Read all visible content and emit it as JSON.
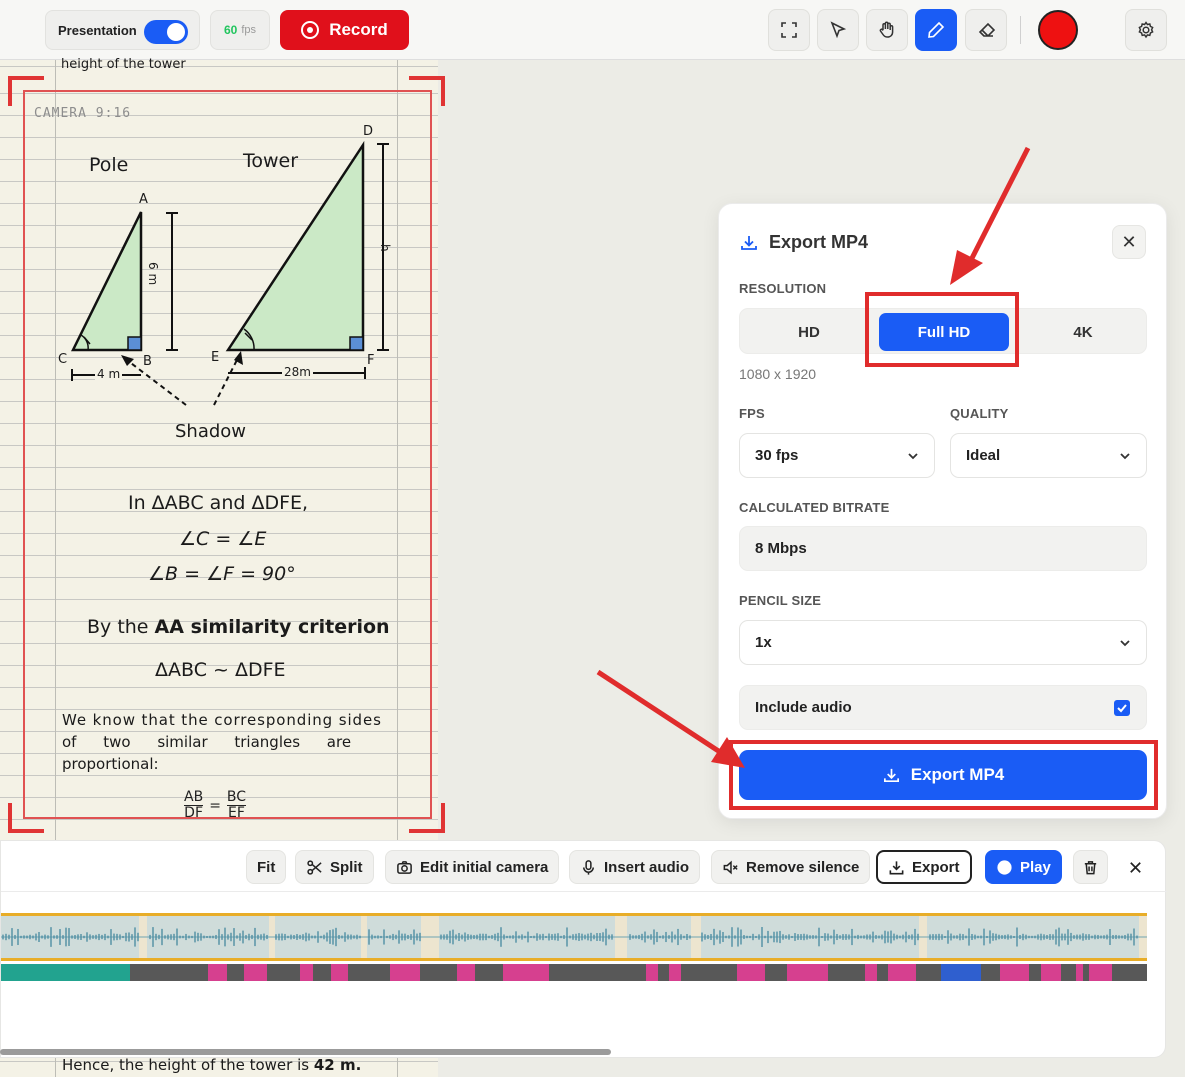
{
  "toolbar": {
    "presentation_label": "Presentation",
    "presentation_on": true,
    "fps_value": "60",
    "fps_unit": "fps",
    "record_label": "Record",
    "tools": [
      "fullscreen-icon",
      "pointer-icon",
      "hand-icon",
      "pencil-icon",
      "eraser-icon"
    ],
    "active_tool": "pencil-icon",
    "pen_color": "#ee1111",
    "settings_icon": "gear-icon"
  },
  "notebook": {
    "top_text": "height of the tower",
    "camera_label": "CAMERA 9:16",
    "pole_label": "Pole",
    "tower_label": "Tower",
    "point_a": "A",
    "point_b": "B",
    "point_c": "C",
    "point_d": "D",
    "point_e": "E",
    "point_f": "F",
    "pole_height": "6 m",
    "tower_height": "h",
    "pole_shadow": "4 m",
    "tower_shadow": "28m",
    "shadow_label": "Shadow",
    "line1": "In ΔABC and ΔDFE,",
    "line2": "∠C = ∠E",
    "line3": "∠B = ∠F = 90°",
    "line4_prefix": "By the ",
    "line4_bold": "AA similarity criterion",
    "line5": "ΔABC ~ ΔDFE",
    "para": [
      "We know that the corresponding sides",
      "of two similar triangles are",
      "proportional:"
    ],
    "frac1_num": "AB",
    "frac1_den": "DF",
    "frac_eq": "=",
    "frac2_num": "BC",
    "frac2_den": "EF",
    "bottom_prefix": "Hence, the height of the tower is ",
    "bottom_value": "42 m."
  },
  "export_panel": {
    "title": "Export MP4",
    "resolution_label": "RESOLUTION",
    "resolution_options": [
      "HD",
      "Full HD",
      "4K"
    ],
    "resolution_selected": "Full HD",
    "resolution_dims": "1080 x 1920",
    "fps_label": "FPS",
    "fps_value": "30 fps",
    "quality_label": "QUALITY",
    "quality_value": "Ideal",
    "bitrate_label": "CALCULATED BITRATE",
    "bitrate_value": "8 Mbps",
    "pencil_label": "PENCIL SIZE",
    "pencil_value": "1x",
    "audio_label": "Include audio",
    "audio_checked": true,
    "export_button": "Export MP4"
  },
  "timeline": {
    "buttons": {
      "fit": "Fit",
      "split": "Split",
      "edit_camera": "Edit initial camera",
      "insert_audio": "Insert audio",
      "remove_silence": "Remove silence",
      "export": "Export",
      "play": "Play"
    }
  },
  "colors": {
    "accent": "#1a5cf5",
    "record": "#e0101b",
    "annotation": "#e02c2c",
    "segment_pink": "#d6408f",
    "segment_teal": "#22a38f",
    "segment_blue": "#2f5fcf"
  }
}
